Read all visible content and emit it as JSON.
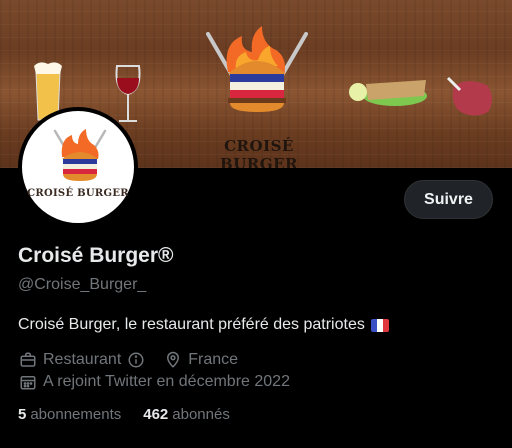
{
  "banner": {
    "restaurant_name": "CROISÉ BURGER"
  },
  "avatar": {
    "name": "CROISÉ BURGER"
  },
  "profile": {
    "follow_label": "Suivre",
    "display_name": "Croisé Burger®",
    "handle": "@Croise_Burger_",
    "bio": "Croisé Burger, le restaurant préféré des patriotes",
    "category": "Restaurant",
    "location": "France",
    "joined": "A rejoint Twitter en décembre 2022",
    "following_count": "5",
    "following_label": "abonnements",
    "followers_count": "462",
    "followers_label": "abonnés"
  },
  "icons": {
    "category": "briefcase-icon",
    "info": "info-icon",
    "location": "location-pin-icon",
    "joined": "calendar-icon",
    "flag": "france-flag-icon"
  },
  "colors": {
    "background": "#000000",
    "text_primary": "#e7e9ea",
    "text_secondary": "#71767b",
    "button_bg": "#202327",
    "flag_blue": "#3b4fc4",
    "flag_white": "#ffffff",
    "flag_red": "#e0373f"
  }
}
